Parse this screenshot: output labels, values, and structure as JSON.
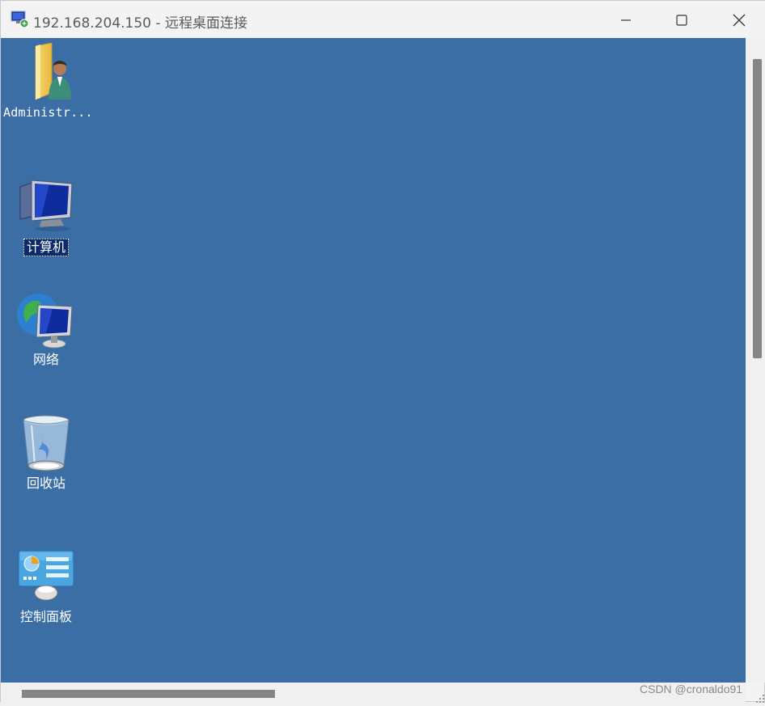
{
  "window": {
    "title": "192.168.204.150 - 远程桌面连接",
    "app_icon": "remote-desktop-icon",
    "controls": [
      "minimize-icon",
      "maximize-icon",
      "close-icon"
    ]
  },
  "desktop": {
    "background_color": "#3a6ea5",
    "icons": [
      {
        "label": "Administr...",
        "icon": "user-folder-icon"
      },
      {
        "label": "计算机",
        "icon": "computer-icon",
        "selected": true
      },
      {
        "label": "网络",
        "icon": "network-icon"
      },
      {
        "label": "回收站",
        "icon": "recycle-bin-icon"
      },
      {
        "label": "控制面板",
        "icon": "control-panel-icon"
      }
    ]
  },
  "watermark": "CSDN @cronaldo91"
}
